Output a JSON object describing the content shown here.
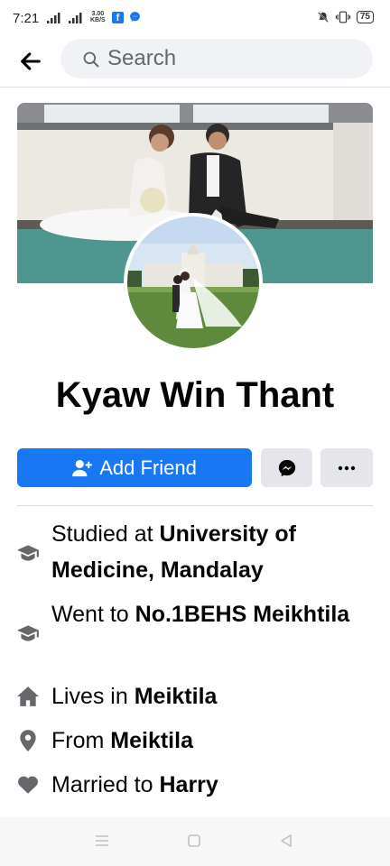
{
  "status_bar": {
    "time": "7:21",
    "net_speed_value": "3.00",
    "net_speed_unit": "KB/S",
    "battery": "75",
    "icons": [
      "signal-icon",
      "facebook-notification-icon",
      "messenger-notification-icon",
      "mute-icon",
      "vibrate-icon",
      "battery-icon"
    ]
  },
  "header": {
    "search_placeholder": "Search",
    "icons": [
      "back-arrow-icon",
      "search-icon"
    ]
  },
  "profile": {
    "name": "Kyaw Win Thant"
  },
  "actions": {
    "add_friend_label": "Add Friend",
    "icons": [
      "add-friend-icon",
      "messenger-icon",
      "more-icon"
    ]
  },
  "intro": [
    {
      "icon": "graduation-cap-icon",
      "prefix": "Studied at ",
      "value": "University of Medicine, Mandalay"
    },
    {
      "icon": "graduation-cap-icon",
      "prefix": "Went to ",
      "value": "No.1BEHS Meikhtila"
    },
    {
      "icon": "home-icon",
      "prefix": "Lives in ",
      "value": "Meiktila"
    },
    {
      "icon": "location-pin-icon",
      "prefix": "From ",
      "value": "Meiktila"
    },
    {
      "icon": "heart-icon",
      "prefix": "Married to ",
      "value": "Harry"
    }
  ],
  "colors": {
    "accent": "#1877f2",
    "secondary_button": "#e4e6eb",
    "icon_gray": "#65676b",
    "search_bg": "#f0f2f5"
  }
}
